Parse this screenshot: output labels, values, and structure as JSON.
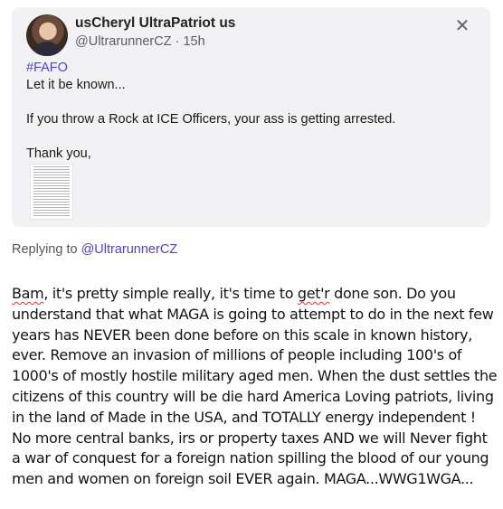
{
  "quoted_post": {
    "display_name": "usCheryl UltraPatriot us",
    "handle": "@UltrarunnerCZ",
    "separator": " · ",
    "time_ago": "15h",
    "close_glyph": "✕",
    "hashtag": "#FAFO",
    "lines": [
      "Let it be known...",
      "If you throw a Rock at ICE Officers, your ass is getting arrested.",
      "Thank you,"
    ]
  },
  "replying": {
    "prefix": "Replying to ",
    "mention": "@UltrarunnerCZ"
  },
  "reply": {
    "lines": [
      {
        "pre": "",
        "flag": "Bam",
        "post": ", it's pretty simple really, it's time to "
      },
      {
        "pre": "",
        "flag": "",
        "post": "understand that what MAGA is going to attempt to do in the next few"
      },
      {
        "pre": "",
        "flag": "",
        "post": "years has NEVER been done before on this scale in known history,"
      },
      {
        "pre": "",
        "flag": "",
        "post": "ever. Remove an invasion of millions of people including 100's of"
      },
      {
        "pre": "",
        "flag": "",
        "post": "1000's of mostly hostile military aged men. When the dust settles the"
      },
      {
        "pre": "",
        "flag": "",
        "post": "citizens of this country will be die hard America Loving patriots, living"
      },
      {
        "pre": "",
        "flag": "",
        "post": "in the land of Made in the USA, and TOTALLY energy independent !"
      },
      {
        "pre": "",
        "flag": "",
        "post": "No more central banks, irs or property taxes AND we will Never fight"
      },
      {
        "pre": "",
        "flag": "",
        "post": "a war of conquest for a foreign nation spilling the blood of our young"
      },
      {
        "pre": "",
        "flag": "",
        "post": "men and women on foreign soil EVER again.  MAGA...WWG1WGA..."
      }
    ],
    "line1_flag2": "get'r",
    "line1_tail": " done son. Do you"
  },
  "colors": {
    "accent": "#5b3bd6",
    "card_bg": "#f2f2f4",
    "spellcheck": "#d33"
  },
  "icons": {
    "close": "close-icon",
    "avatar": "avatar"
  }
}
